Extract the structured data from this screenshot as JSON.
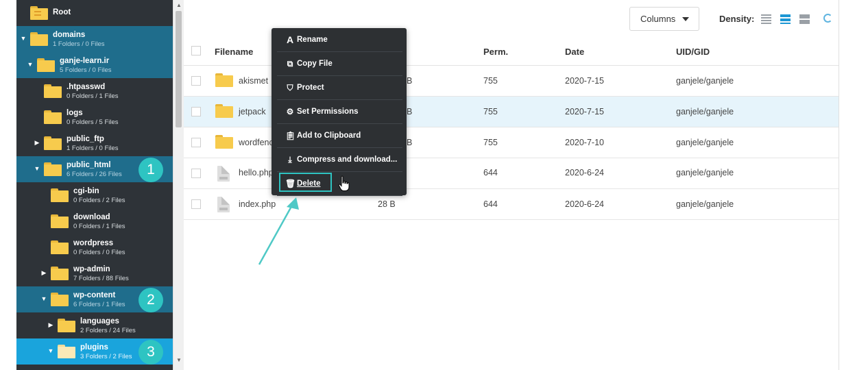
{
  "sidebar": {
    "items": [
      {
        "name": "Root",
        "meta": "",
        "arrow": "",
        "badge": ""
      },
      {
        "name": "domains",
        "meta": "1 Folders / 0 Files",
        "arrow": "▼",
        "badge": ""
      },
      {
        "name": "ganje-learn.ir",
        "meta": "5 Folders / 0 Files",
        "arrow": "▼",
        "badge": ""
      },
      {
        "name": ".htpasswd",
        "meta": "0 Folders / 1 Files",
        "arrow": "",
        "badge": ""
      },
      {
        "name": "logs",
        "meta": "0 Folders / 5 Files",
        "arrow": "",
        "badge": ""
      },
      {
        "name": "public_ftp",
        "meta": "1 Folders / 0 Files",
        "arrow": "▶",
        "badge": ""
      },
      {
        "name": "public_html",
        "meta": "6 Folders / 26 Files",
        "arrow": "▼",
        "badge": "1"
      },
      {
        "name": "cgi-bin",
        "meta": "0 Folders / 2 Files",
        "arrow": "",
        "badge": ""
      },
      {
        "name": "download",
        "meta": "0 Folders / 1 Files",
        "arrow": "",
        "badge": ""
      },
      {
        "name": "wordpress",
        "meta": "0 Folders / 0 Files",
        "arrow": "",
        "badge": ""
      },
      {
        "name": "wp-admin",
        "meta": "7 Folders / 88 Files",
        "arrow": "▶",
        "badge": ""
      },
      {
        "name": "wp-content",
        "meta": "6 Folders / 1 Files",
        "arrow": "▼",
        "badge": "2"
      },
      {
        "name": "languages",
        "meta": "2 Folders / 24 Files",
        "arrow": "▶",
        "badge": ""
      },
      {
        "name": "plugins",
        "meta": "3 Folders / 2 Files",
        "arrow": "▼",
        "badge": "3"
      }
    ]
  },
  "toolbar": {
    "columns_label": "Columns",
    "density_label": "Density:"
  },
  "table": {
    "headers": {
      "filename": "Filename",
      "perm": "Perm.",
      "date": "Date",
      "uid": "UID/GID"
    },
    "rows": [
      {
        "name": "akismet",
        "size": "B",
        "perm": "755",
        "date": "2020-7-15",
        "uid": "ganjele/ganjele",
        "type": "folder"
      },
      {
        "name": "jetpack",
        "size": "B",
        "perm": "755",
        "date": "2020-7-15",
        "uid": "ganjele/ganjele",
        "type": "folder"
      },
      {
        "name": "wordfenc",
        "size": "B",
        "perm": "755",
        "date": "2020-7-10",
        "uid": "ganjele/ganjele",
        "type": "folder"
      },
      {
        "name": "hello.php",
        "size": "",
        "perm": "644",
        "date": "2020-6-24",
        "uid": "ganjele/ganjele",
        "type": "file"
      },
      {
        "name": "index.php",
        "size": "28 B",
        "perm": "644",
        "date": "2020-6-24",
        "uid": "ganjele/ganjele",
        "type": "file"
      }
    ]
  },
  "context_menu": {
    "items": [
      {
        "label": "Rename",
        "icon": "rename-icon"
      },
      {
        "label": "Copy File",
        "icon": "copy-icon"
      },
      {
        "label": "Protect",
        "icon": "shield-icon"
      },
      {
        "label": "Set Permissions",
        "icon": "gear-icon"
      },
      {
        "label": "Add to Clipboard",
        "icon": "clipboard-icon"
      },
      {
        "label": "Compress and download...",
        "icon": "download-icon"
      },
      {
        "label": "Delete",
        "icon": "trash-icon"
      }
    ]
  },
  "colors": {
    "sidebar_bg": "#2e3338",
    "selected_dark": "#1f6d8c",
    "selected_bright": "#1aa4dc",
    "badge": "#2ec4c2",
    "row_highlight": "#e6f4fb",
    "menu_bg": "#2d3033"
  }
}
